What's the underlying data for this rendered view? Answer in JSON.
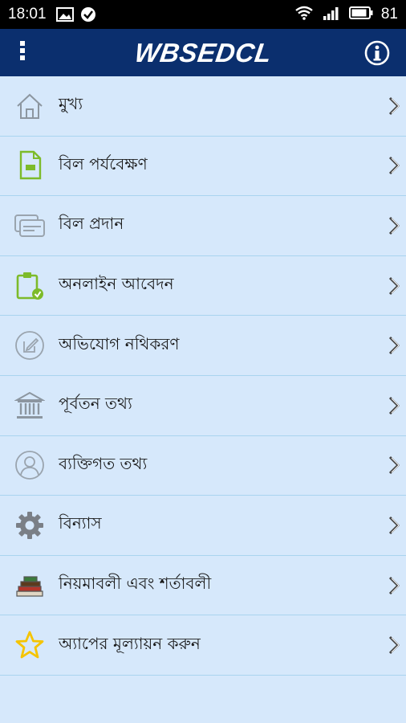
{
  "status_bar": {
    "time": "18:01",
    "left_icons": [
      "image-icon",
      "check-circle-icon"
    ],
    "right_icons": [
      "wifi-icon",
      "signal-icon",
      "battery-icon"
    ],
    "battery": "81"
  },
  "app_bar": {
    "logo": "WBSEDCL",
    "menu_icon": "overflow-menu-icon",
    "info_icon": "info-icon",
    "color": "#0b2f6e"
  },
  "menu": {
    "items": [
      {
        "label": "মুখ্য",
        "icon": "home-icon"
      },
      {
        "label": "বিল পর্যবেক্ষণ",
        "icon": "bill-document-icon"
      },
      {
        "label": "বিল প্রদান",
        "icon": "payment-card-icon"
      },
      {
        "label": "অনলাইন আবেদন",
        "icon": "clipboard-check-icon"
      },
      {
        "label": "অভিযোগ নথিকরণ",
        "icon": "edit-complaint-icon"
      },
      {
        "label": "পূর্বতন তথ্য",
        "icon": "bank-building-icon"
      },
      {
        "label": "ব্যক্তিগত তথ্য",
        "icon": "user-profile-icon"
      },
      {
        "label": "বিন্যাস",
        "icon": "gear-icon"
      },
      {
        "label": "নিয়মাবলী এবং শর্তাবলী",
        "icon": "books-icon"
      },
      {
        "label": "অ্যাপের মূল্যায়ন করুন",
        "icon": "star-icon"
      }
    ]
  },
  "colors": {
    "background": "#d6e8fb",
    "divider": "#a9d4ef",
    "accent_green": "#8cc63e",
    "star_yellow": "#f5c400"
  }
}
